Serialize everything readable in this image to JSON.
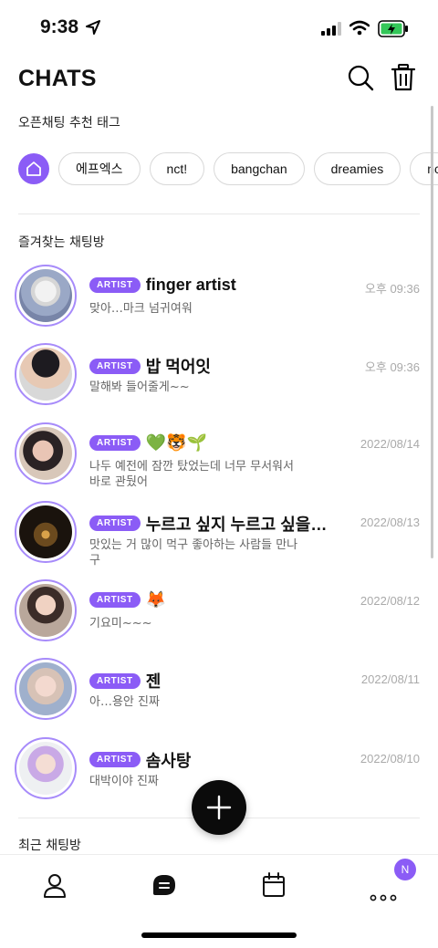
{
  "status_bar": {
    "time": "9:38"
  },
  "header": {
    "title": "CHATS"
  },
  "tags": {
    "label": "오픈채팅 추천 태그",
    "items": [
      "에프엑스",
      "nct!",
      "bangchan",
      "dreamies",
      "ncts"
    ]
  },
  "favorites": {
    "label": "즐겨찾는 채팅방",
    "items": [
      {
        "badge": "ARTIST",
        "name": "finger artist",
        "time": "오후 09:36",
        "preview": "맞아…마크 넘귀여워"
      },
      {
        "badge": "ARTIST",
        "name": "밥 먹어잇",
        "time": "오후 09:36",
        "preview": "말해봐 들어줄게~~"
      },
      {
        "badge": "ARTIST",
        "name": "💚🐯🌱",
        "time": "2022/08/14",
        "preview": "나두 예전에 잠깐 탔었는데 너무 무서워서 바로 관뒀어"
      },
      {
        "badge": "ARTIST",
        "name": "누르고 싶지 누르고 싶을꺼…",
        "time": "2022/08/13",
        "preview": "맛있는 거 많이 먹구 좋아하는 사람들 만나구"
      },
      {
        "badge": "ARTIST",
        "name": "🦊",
        "time": "2022/08/12",
        "preview": "기요미~~~"
      },
      {
        "badge": "ARTIST",
        "name": "젠",
        "time": "2022/08/11",
        "preview": "아…용안 진짜"
      },
      {
        "badge": "ARTIST",
        "name": "솜사탕",
        "time": "2022/08/10",
        "preview": "대박이야 진짜"
      }
    ]
  },
  "recent": {
    "label": "최근 채팅방"
  },
  "tab_bar": {
    "more_badge": "N"
  },
  "colors": {
    "accent": "#8b5cf6",
    "fab": "#0b0b0b"
  }
}
